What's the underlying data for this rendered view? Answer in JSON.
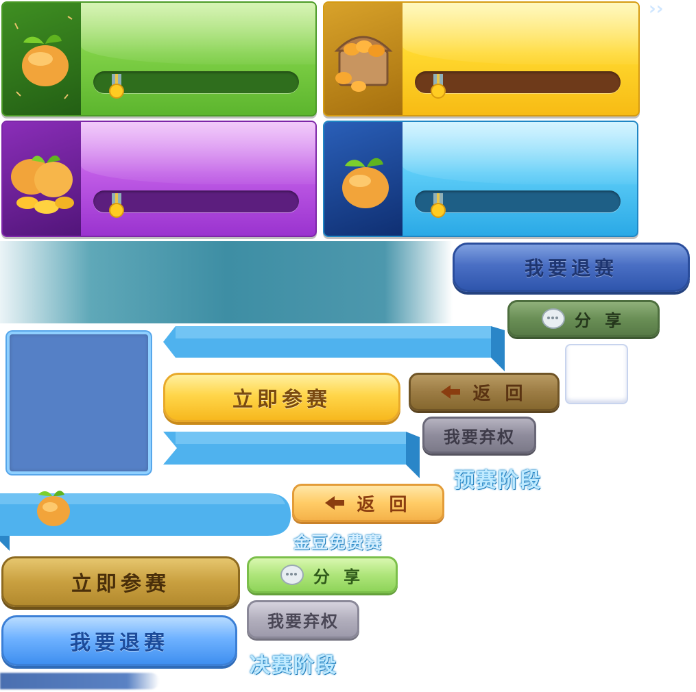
{
  "panels": [
    {
      "id": "green",
      "color": "#6cc23a",
      "dark": "#2e7d1a",
      "track": "#2f6e1d",
      "icon": "bean-sprout-icon"
    },
    {
      "id": "yellow",
      "color": "#ffcf2a",
      "dark": "#c28a12",
      "track": "#6e3a1a",
      "icon": "treasure-chest-icon"
    },
    {
      "id": "purple",
      "color": "#b54fe0",
      "dark": "#6a1e8c",
      "track": "#5c1e7e",
      "icon": "beans-pile-icon"
    },
    {
      "id": "blue",
      "color": "#47c2f5",
      "dark": "#1a4f9e",
      "track": "#1e5f86",
      "icon": "bean-sprout-icon"
    }
  ],
  "buttons": {
    "quit_dark": "我要退赛",
    "share_dark": "分 享",
    "back_dark": "返 回",
    "join_yellow": "立即参赛",
    "forfeit_dark": "我要弃权",
    "back_light": "返 回",
    "join_gold": "立即参赛",
    "share_light": "分 享",
    "forfeit_light": "我要弃权",
    "quit_light": "我要退赛"
  },
  "labels": {
    "prelim_stage": "预赛阶段",
    "free_match": "金豆免费赛",
    "final_stage": "决赛阶段",
    "arrows": "››"
  },
  "colors": {
    "ribbon": "#4fb2ee",
    "ribbon_dark": "#2a86c8",
    "square_blue": "#5580c6"
  }
}
